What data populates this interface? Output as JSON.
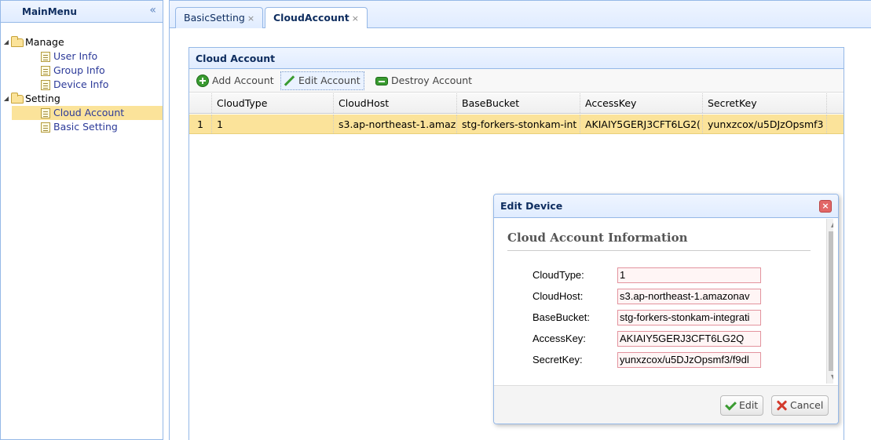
{
  "main_menu": {
    "title": "MainMenu",
    "collapse_glyph": "«",
    "tree": [
      {
        "label": "Manage",
        "type": "folder",
        "expanded": true
      },
      {
        "label": "User Info",
        "type": "leaf"
      },
      {
        "label": "Group Info",
        "type": "leaf"
      },
      {
        "label": "Device Info",
        "type": "leaf"
      },
      {
        "label": "Setting",
        "type": "folder",
        "expanded": true
      },
      {
        "label": "Cloud Account",
        "type": "leaf",
        "selected": true
      },
      {
        "label": "Basic Setting",
        "type": "leaf"
      }
    ]
  },
  "tabs": [
    {
      "label": "BasicSetting",
      "close": "×"
    },
    {
      "label": "CloudAccount",
      "close": "×",
      "active": true
    }
  ],
  "grid": {
    "title": "Cloud Account",
    "toolbar": {
      "add": "Add Account",
      "edit": "Edit Account",
      "destroy": "Destroy Account"
    },
    "columns": [
      "CloudType",
      "CloudHost",
      "BaseBucket",
      "AccessKey",
      "SecretKey"
    ],
    "rows": [
      {
        "rownum": "1",
        "cells": [
          "1",
          "s3.ap-northeast-1.amaz",
          "stg-forkers-stonkam-int",
          "AKIAIY5GERJ3CFT6LG2(",
          "yunxzcox/u5DJzOpsmf3"
        ]
      }
    ]
  },
  "dialog": {
    "title": "Edit Device",
    "close_glyph": "×",
    "section_title": "Cloud Account Information",
    "fields": [
      {
        "label": "CloudType:",
        "value": "1"
      },
      {
        "label": "CloudHost:",
        "value": "s3.ap-northeast-1.amazonav"
      },
      {
        "label": "BaseBucket:",
        "value": "stg-forkers-stonkam-integrati"
      },
      {
        "label": "AccessKey:",
        "value": "AKIAIY5GERJ3CFT6LG2Q"
      },
      {
        "label": "SecretKey:",
        "value": "yunxzcox/u5DJzOpsmf3/f9dl"
      }
    ],
    "buttons": {
      "edit": "Edit",
      "cancel": "Cancel"
    },
    "scroll_up_glyph": "▲",
    "scroll_down_glyph": "▼"
  },
  "colors": {
    "border_blue": "#95b8e7",
    "header_text": "#0e2d5f",
    "selected_row": "#fbe39a",
    "invalid_border": "#e3939e",
    "icon_green": "#3a9b31",
    "icon_red": "#d33a2c"
  },
  "icons": {
    "tree_expanded": "triangle-down-icon",
    "folder": "folder-open-icon",
    "leaf": "document-icon",
    "add": "plus-circle-icon",
    "edit": "pencil-icon",
    "destroy": "minus-rectangle-icon",
    "ok": "check-icon",
    "cancel": "x-icon",
    "dialog_close": "close-icon"
  }
}
